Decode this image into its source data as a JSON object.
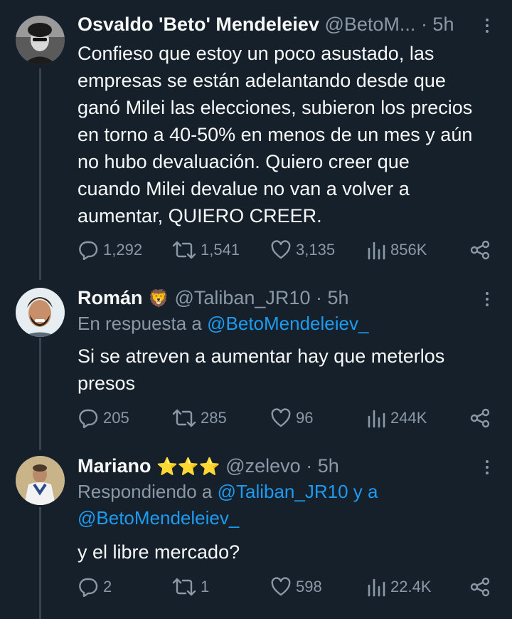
{
  "tweets": [
    {
      "name": "Osvaldo 'Beto' Mendeleiev",
      "handle": "@BetoM...",
      "time": "· 5h",
      "text_lines": [
        "Confieso que estoy un poco asustado, las",
        "empresas se están adelantando desde que",
        "ganó Milei las elecciones, subieron los precios",
        "en torno a 40-50% en menos de un mes y aún",
        "no hubo devaluación. Quiero creer que",
        "cuando Milei devalue no van a volver a",
        "aumentar, QUIERO CREER."
      ],
      "replies": "1,292",
      "retweets": "1,541",
      "likes": "3,135",
      "views": "856K"
    },
    {
      "name": "Román",
      "name_emoji": "🦁",
      "handle": "@Taliban_JR10",
      "time": "· 5h",
      "reply_prefix": "En respuesta a ",
      "reply_mention": "@BetoMendeleiev_",
      "text_lines": [
        "Si se atreven a aumentar hay que meterlos",
        "presos"
      ],
      "replies": "205",
      "retweets": "285",
      "likes": "96",
      "views": "244K"
    },
    {
      "name": "Mariano",
      "name_emoji": "⭐⭐⭐",
      "handle": "@zelevo",
      "time": "· 5h",
      "reply_prefix": "Respondiendo a ",
      "reply_mention": "@Taliban_JR10 y a",
      "reply_mention2": "@BetoMendeleiev_",
      "text_lines": [
        "y el libre mercado?"
      ],
      "replies": "2",
      "retweets": "1",
      "likes": "598",
      "views": "22.4K"
    }
  ],
  "colors": {
    "background": "#15202b",
    "text": "#f7f9f9",
    "secondary": "#8b98a5",
    "link": "#1d9bf0",
    "thread_line": "#38444d"
  }
}
